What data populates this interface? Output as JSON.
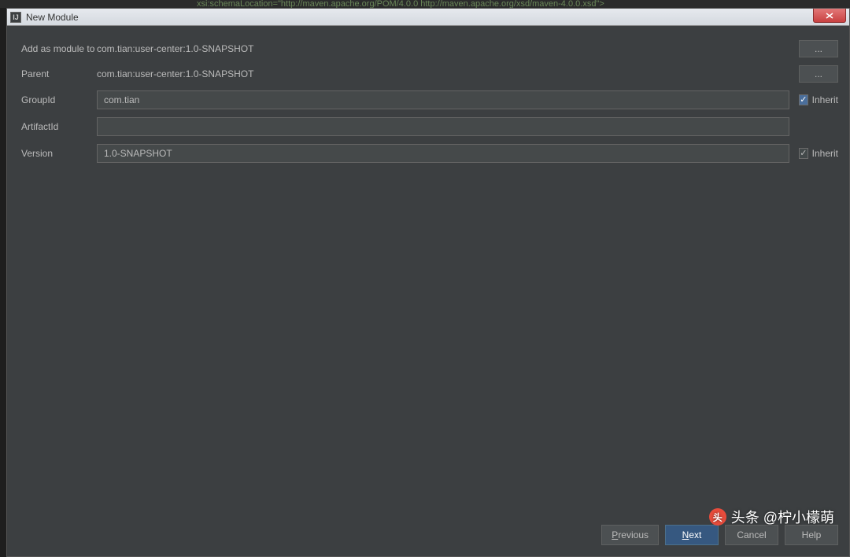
{
  "background": {
    "code_snippet": "xsi:schemaLocation=\"http://maven.apache.org/POM/4.0.0 http://maven.apache.org/xsd/maven-4.0.0.xsd\">"
  },
  "dialog": {
    "title": "New Module",
    "icon_char": "IJ"
  },
  "form": {
    "add_as_module_label": "Add as module to",
    "add_as_module_value": "com.tian:user-center:1.0-SNAPSHOT",
    "parent_label": "Parent",
    "parent_value": "com.tian:user-center:1.0-SNAPSHOT",
    "groupid_label": "GroupId",
    "groupid_value": "com.tian",
    "groupid_inherit_checked": true,
    "artifactid_label": "ArtifactId",
    "artifactid_value": "",
    "version_label": "Version",
    "version_value": "1.0-SNAPSHOT",
    "version_inherit_checked": true,
    "inherit_label": "Inherit",
    "browse_label": "..."
  },
  "footer": {
    "previous": "Previous",
    "next": "Next",
    "cancel": "Cancel",
    "help": "Help"
  },
  "watermark": {
    "text": "头条 @柠小檬萌"
  }
}
